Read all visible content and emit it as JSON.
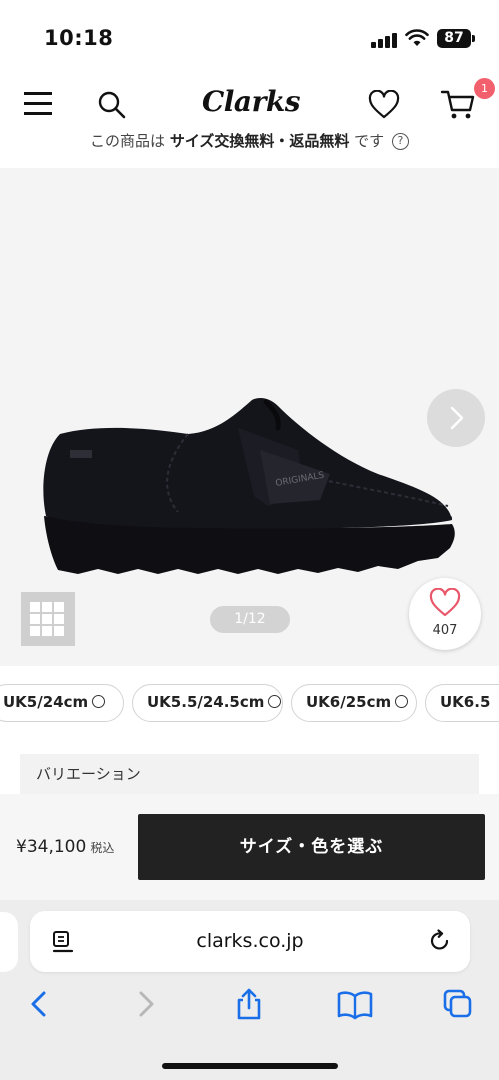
{
  "status": {
    "time": "10:18",
    "battery": "87"
  },
  "header": {
    "logo": "Clarks",
    "cart_count": "1",
    "promo_prefix": "この商品は ",
    "promo_bold": "サイズ交換無料・返品無料",
    "promo_suffix": " です",
    "promo_help": "?"
  },
  "product": {
    "pager": "1/12",
    "like_count": "407"
  },
  "sizes": [
    {
      "label": "UK5/24cm"
    },
    {
      "label": "UK5.5/24.5cm"
    },
    {
      "label": "UK6/25cm"
    },
    {
      "label": "UK6.5"
    }
  ],
  "variation_label": "バリエーション",
  "buy": {
    "price": "¥34,100",
    "tax": "税込",
    "select_label": "サイズ・色を選ぶ"
  },
  "browser": {
    "url": "clarks.co.jp"
  },
  "colors": {
    "accent_dark": "#222222",
    "badge": "#f2606d",
    "heart": "#e8576a"
  },
  "icons": [
    "menu-icon",
    "search-icon",
    "heart-icon",
    "cart-icon",
    "chevron-right-icon",
    "grid-icon",
    "reader-icon",
    "reload-icon",
    "back-icon",
    "forward-icon",
    "share-icon",
    "bookmarks-icon",
    "tabs-icon"
  ]
}
